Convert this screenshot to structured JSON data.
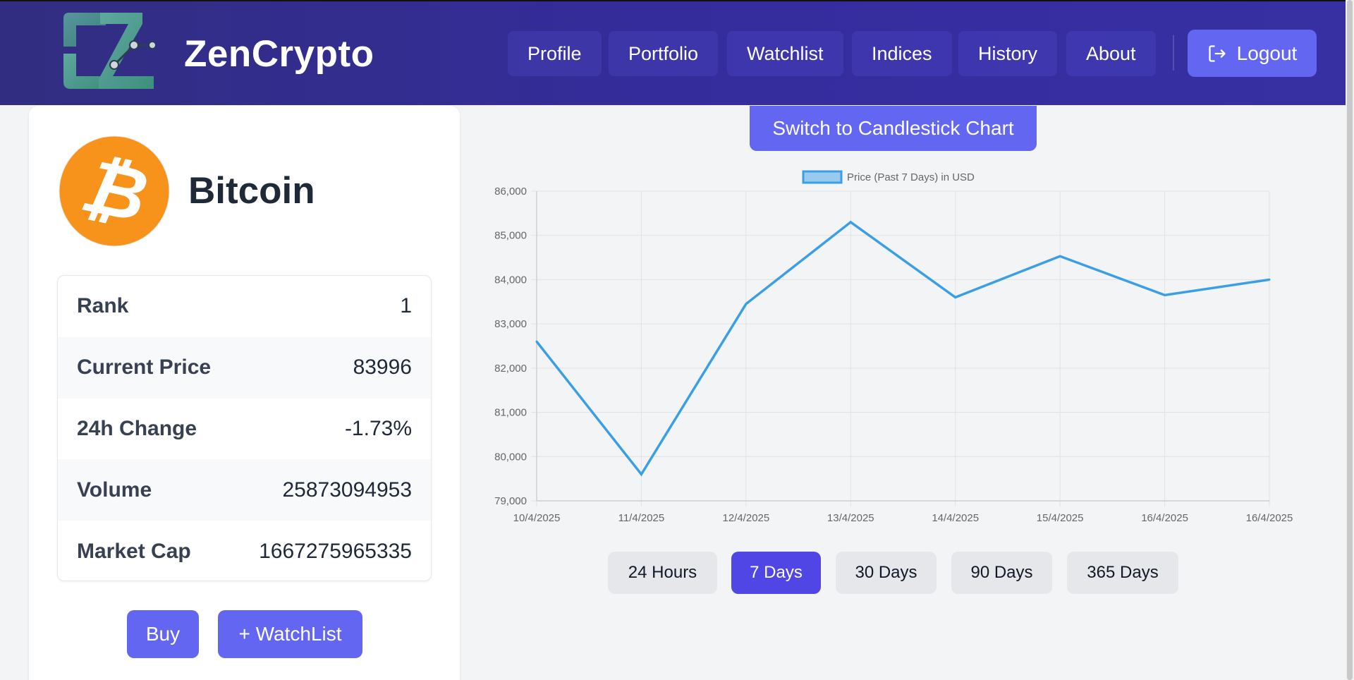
{
  "header": {
    "brand": "ZenCrypto",
    "nav": [
      "Profile",
      "Portfolio",
      "Watchlist",
      "Indices",
      "History",
      "About"
    ],
    "logout_label": "Logout",
    "logo_icon": "zencrypto-logo",
    "logout_icon": "logout-icon"
  },
  "coin": {
    "name": "Bitcoin",
    "icon": "bitcoin-icon",
    "stats": [
      {
        "label": "Rank",
        "value": "1"
      },
      {
        "label": "Current Price",
        "value": "83996"
      },
      {
        "label": "24h Change",
        "value": "-1.73%"
      },
      {
        "label": "Volume",
        "value": "25873094953"
      },
      {
        "label": "Market Cap",
        "value": "1667275965335"
      }
    ],
    "buy_label": "Buy",
    "watchlist_label": "+ WatchList"
  },
  "chart_controls": {
    "switch_label": "Switch to Candlestick Chart",
    "ranges": [
      "24 Hours",
      "7 Days",
      "30 Days",
      "90 Days",
      "365 Days"
    ],
    "active_range": "7 Days"
  },
  "colors": {
    "accent": "#6366f1",
    "active": "#4f46e5",
    "line": "#3b9fe6",
    "bitcoin": "#f7931a"
  },
  "chart_data": {
    "type": "line",
    "categories": [
      "10/4/2025",
      "11/4/2025",
      "12/4/2025",
      "13/4/2025",
      "14/4/2025",
      "15/4/2025",
      "16/4/2025",
      "16/4/2025"
    ],
    "series": [
      {
        "name": "Price (Past 7 Days) in USD",
        "values": [
          82600,
          79600,
          83450,
          85300,
          83600,
          84530,
          83650,
          84000
        ]
      }
    ],
    "ylim": [
      79000,
      86000
    ],
    "yticks": [
      "86,000",
      "85,000",
      "84,000",
      "83,000",
      "82,000",
      "81,000",
      "80,000",
      "79,000"
    ],
    "grid": true,
    "legend": "top-center"
  }
}
